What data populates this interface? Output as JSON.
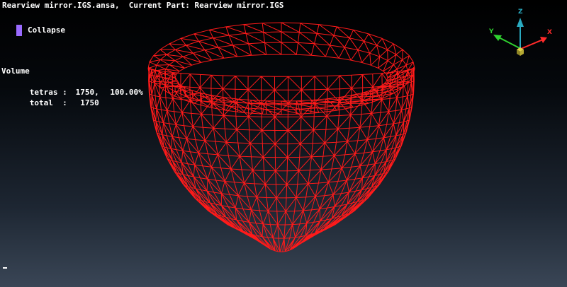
{
  "header": {
    "title": "Rearview mirror.IGS.ansa,  Current Part: Rearview mirror.IGS"
  },
  "collapse": {
    "label": "Collapse",
    "color": "#9a6bff"
  },
  "stats": {
    "heading": "Volume",
    "rows": [
      {
        "name": "tetras :",
        "count": "1750,",
        "percent": "100.00%"
      },
      {
        "name": "total  :",
        "count": "1750",
        "percent": ""
      }
    ]
  },
  "axis": {
    "x_label": "X",
    "y_label": "Y",
    "z_label": "Z",
    "x_color": "#ff2a2a",
    "y_color": "#2fd12f",
    "z_color": "#2aaac0"
  },
  "mesh": {
    "color": "#ff1a1a",
    "shape": "cup-shaped tetra mesh wireframe"
  }
}
